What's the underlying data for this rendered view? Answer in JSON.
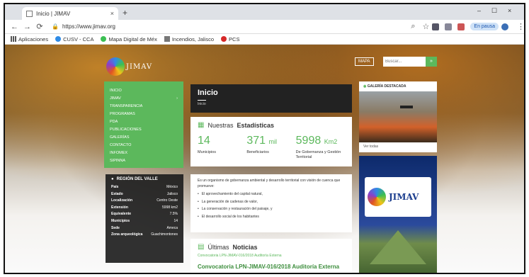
{
  "browser": {
    "tab_title": "Inicio | JIMAV",
    "tab_close": "×",
    "new_tab": "+",
    "url": "https://www.jimav.org",
    "pause_label": "En pausa",
    "window_min": "–",
    "window_max": "☐",
    "window_close": "×"
  },
  "bookmarks": [
    {
      "label": "Aplicaciones",
      "color": "#e05423"
    },
    {
      "label": "CUSV - CCA",
      "color": "#2f8be6"
    },
    {
      "label": "Mapa Digital de Méx",
      "color": "#3bbf52"
    },
    {
      "label": "Incendios, Jalisco",
      "color": "#777777"
    },
    {
      "label": "PCS",
      "color": "#d62828"
    }
  ],
  "site": {
    "logo_text": "JIMAV",
    "mapa_label": "MAPA",
    "search_placeholder": "Buscar...",
    "search_button": "»"
  },
  "menu": [
    {
      "label": "Inicio"
    },
    {
      "label": "JIMAV",
      "arrow": "›"
    },
    {
      "label": "Transparencia"
    },
    {
      "label": "Programas"
    },
    {
      "label": "PDA"
    },
    {
      "label": "Publicaciones"
    },
    {
      "label": "Galerías"
    },
    {
      "label": "Contacto"
    },
    {
      "label": "Infomex"
    },
    {
      "label": "SIPINNA"
    }
  ],
  "region": {
    "title": "REGIÓN DEL VALLE",
    "rows": [
      {
        "k": "País",
        "v": "México"
      },
      {
        "k": "Estado",
        "v": "Jalisco"
      },
      {
        "k": "Localización",
        "v": "Centro Oeste"
      },
      {
        "k": "Extensión",
        "v": "5998 km2"
      },
      {
        "k": "Equivalente",
        "v": "7.5%"
      },
      {
        "k": "Municipios",
        "v": "14"
      },
      {
        "k": "Sede",
        "v": "Ameca"
      },
      {
        "k": "Zona arqueológica",
        "v": "Guachimontones"
      }
    ]
  },
  "main": {
    "title": "Inicio",
    "breadcrumb": "Inicio",
    "stats_title_prefix": "Nuestras",
    "stats_title_bold": "Estadísticas",
    "stats": [
      {
        "value": "14",
        "unit": "",
        "label": "Municipios"
      },
      {
        "value": "371",
        "unit": "mil",
        "label": "Beneficiarios"
      },
      {
        "value": "5998",
        "unit": "Km2",
        "label": "De Gobernanza y Gestión Territorial"
      }
    ],
    "about_intro": "Es un organismo de gobernanza ambiental y desarrollo territorial con visión de cuenca que promueve:",
    "about_items": [
      "El aprovechamiento del capital natural,",
      "La generación de cadenas de valor,",
      "La conservación y restauración del paisaje, y",
      "El desarrollo social de los habitantes"
    ],
    "news_title_prefix": "Últimas",
    "news_title_bold": "Noticias",
    "news_image_alt": "Convocatoria LPN-JIMAV-016/2018 Auditoría Externa",
    "news_link": "Convocatoria LPN-JIMAV-016/2018 Auditoría Externa"
  },
  "gallery": {
    "title": "GALERÍA DESTACADA",
    "caption": "Ver todas"
  },
  "poster": {
    "logo_text": "JIMAV"
  }
}
